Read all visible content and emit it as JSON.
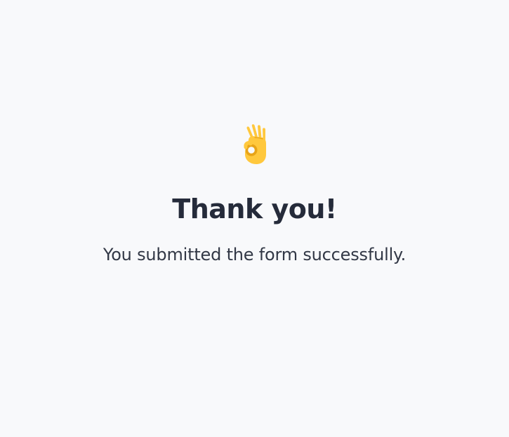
{
  "success_page": {
    "icon": "ok-hand-icon",
    "title": "Thank you!",
    "message": "You submitted the form successfully."
  },
  "colors": {
    "background": "#f8f9fb",
    "title_text": "#252b3a",
    "message_text": "#323846",
    "emoji_yellow": "#ffc83d",
    "emoji_shade": "#e8a417"
  }
}
